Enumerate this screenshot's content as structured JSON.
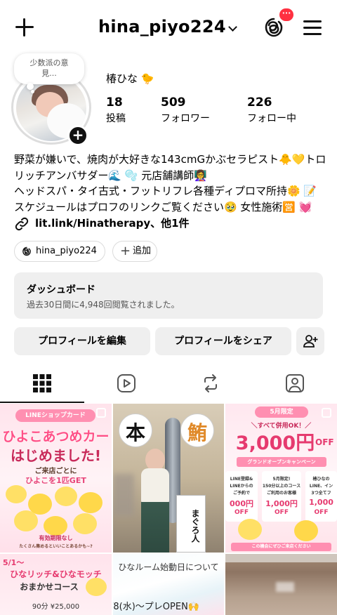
{
  "header": {
    "username": "hina_piyo224",
    "notification_badge": "···",
    "icons": [
      "plus-icon",
      "chevron-down-icon",
      "threads-icon",
      "menu-icon"
    ]
  },
  "note": {
    "text_line1": "少数派の意",
    "text_line2": "見..."
  },
  "profile": {
    "display_name": "椿ひな 🐤",
    "stats": [
      {
        "value": "18",
        "label": "投稿"
      },
      {
        "value": "509",
        "label": "フォロワー"
      },
      {
        "value": "226",
        "label": "フォロー中"
      }
    ],
    "bio": [
      "野菜が嫌いで、焼肉が大好きな143cmGかぶセラピスト🐥💛トロリッチアンバサダー🌊 🫧 元店舗講師👩‍🏫",
      "ヘッドスパ・タイ古式・フットリフレ各種ディプロマ所持🌼 📝",
      "スケジュールはプロフのリンクご覧ください🥹 女性施術🈺 💓"
    ],
    "link": "lit.link/Hinatherapy、他1件"
  },
  "pills": {
    "threads_label": "hina_piyo224",
    "add_label": "追加"
  },
  "dashboard": {
    "title": "ダッシュボード",
    "subtitle": "過去30日間に4,948回閲覧されました。"
  },
  "buttons": {
    "edit_profile": "プロフィールを編集",
    "share_profile": "プロフィールをシェア"
  },
  "tabs": [
    "grid-icon",
    "reels-icon",
    "reposts-icon",
    "tagged-icon"
  ],
  "posts": {
    "p1": {
      "top": "LINEショップカード",
      "title1": "ひよこあつめカー",
      "title2": "はじめました!",
      "line1": "ご来店ごとに",
      "line2": "ひよこを1匹GET",
      "note": "有効期限なし",
      "foot": "たくさん集めるといいことあるかも~?"
    },
    "p2": {
      "sign1": "本",
      "sign2": "鮪",
      "fish_label": "まぐろ人"
    },
    "p3": {
      "top": "5月限定",
      "head": "＼すべて併用OK！／",
      "big": "3,000円",
      "off": "OFF",
      "sub": "グランドオープンキャンペーン",
      "a_line1": "LINE登録&",
      "a_line2": "LINEからの",
      "a_line3": "ご予約で",
      "a_price": "000円",
      "b_line1": "5月限定!",
      "b_line2": "150分以上のコース",
      "b_line3": "ご利用のお客様",
      "b_price": "1,000円",
      "c_line1": "椿ひなの",
      "c_line2": "LINE、イン",
      "c_line3": "3つ全てフ",
      "c_price": "1,000",
      "off_small": "OFF",
      "foot": "この機会にぜひご来店ください"
    },
    "p4": {
      "date": "5/1～",
      "title1": "ひなリッチ&ひなモッチ",
      "title2": "おまかせコース",
      "price": "90分 ¥25,000"
    },
    "p5": {
      "line1": "ひなルーム始動日について",
      "line2": "/8(水)～プレOPEN🙌"
    }
  },
  "colors": {
    "badge": "#ff3040",
    "pill_border": "#dbdbdb",
    "button_bg": "#efefef",
    "pink": "#ff7fa8"
  }
}
